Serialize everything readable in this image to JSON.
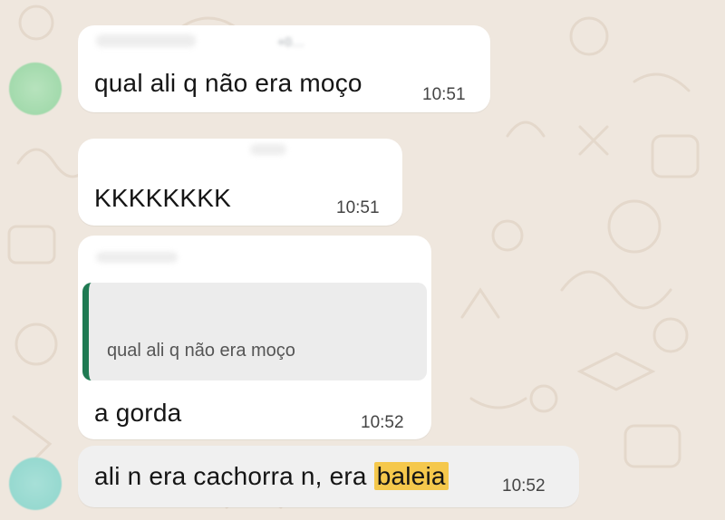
{
  "messages": [
    {
      "sender": "+0…",
      "text": "qual ali q não era moço",
      "time": "10:51"
    },
    {
      "text": "KKKKKKKK",
      "time": "10:51"
    },
    {
      "reply": {
        "quoted_text": "qual ali q não era moço"
      },
      "text": "a gorda",
      "time": "10:52"
    },
    {
      "text_before": "ali n era cachorra n, era ",
      "highlighted_word": "baleia",
      "time": "10:52"
    }
  ],
  "colors": {
    "background": "#efe7de",
    "bubble": "#ffffff",
    "quote_bar": "#1f7a52",
    "highlight": "#f5c84c",
    "avatar_top": "#a8dcb0",
    "avatar_bottom": "#8fd6cc"
  }
}
